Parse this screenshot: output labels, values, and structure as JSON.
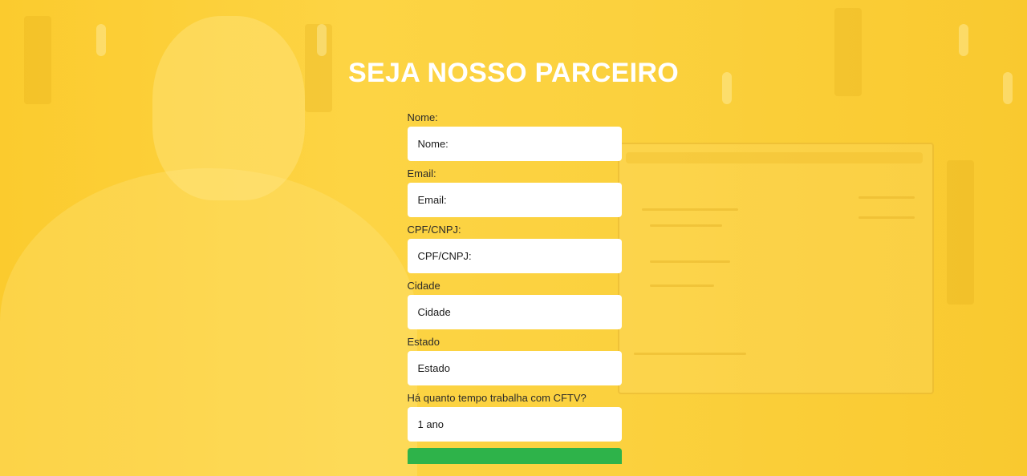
{
  "page": {
    "title": "SEJA NOSSO PARCEIRO"
  },
  "form": {
    "fields": [
      {
        "label": "Nome:",
        "placeholder": "Nome:",
        "type": "text"
      },
      {
        "label": "Email:",
        "placeholder": "Email:",
        "type": "email"
      },
      {
        "label": "CPF/CNPJ:",
        "placeholder": "CPF/CNPJ:",
        "type": "text"
      },
      {
        "label": "Cidade",
        "placeholder": "Cidade",
        "type": "text"
      },
      {
        "label": "Estado",
        "placeholder": "Estado",
        "type": "text"
      },
      {
        "label": "Há quanto tempo trabalha com CFTV?",
        "value": "1 ano",
        "type": "select"
      }
    ],
    "submit_label": ""
  },
  "colors": {
    "background": "#fbcf3a",
    "title": "#ffffff",
    "input_bg": "#ffffff",
    "submit": "#2eb34a"
  }
}
